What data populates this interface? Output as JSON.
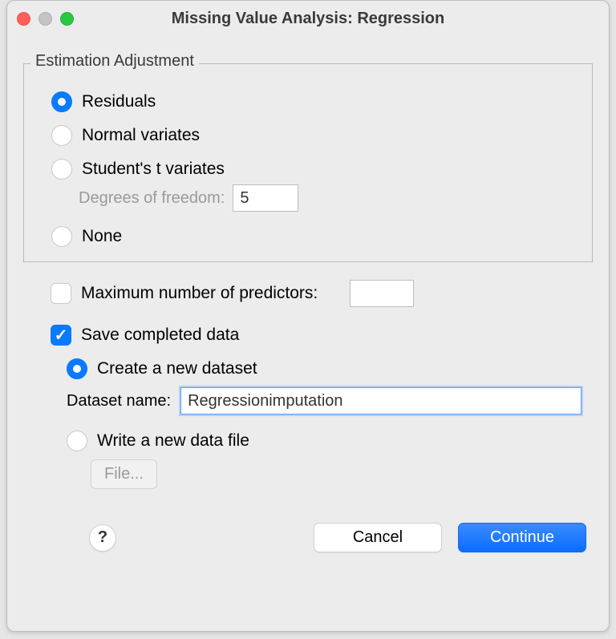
{
  "window": {
    "title": "Missing Value Analysis: Regression"
  },
  "estimation": {
    "legend": "Estimation Adjustment",
    "residuals": "Residuals",
    "normal": "Normal variates",
    "student": "Student's t variates",
    "dof_label": "Degrees of freedom:",
    "dof_value": "5",
    "none": "None"
  },
  "max_predictors": {
    "label": "Maximum number of predictors:",
    "value": ""
  },
  "save": {
    "label": "Save completed data",
    "create_label": "Create a new dataset",
    "ds_label": "Dataset name:",
    "ds_value": "Regressionimputation",
    "write_label": "Write a new data file",
    "file_btn": "File..."
  },
  "buttons": {
    "help": "?",
    "cancel": "Cancel",
    "continue": "Continue"
  }
}
